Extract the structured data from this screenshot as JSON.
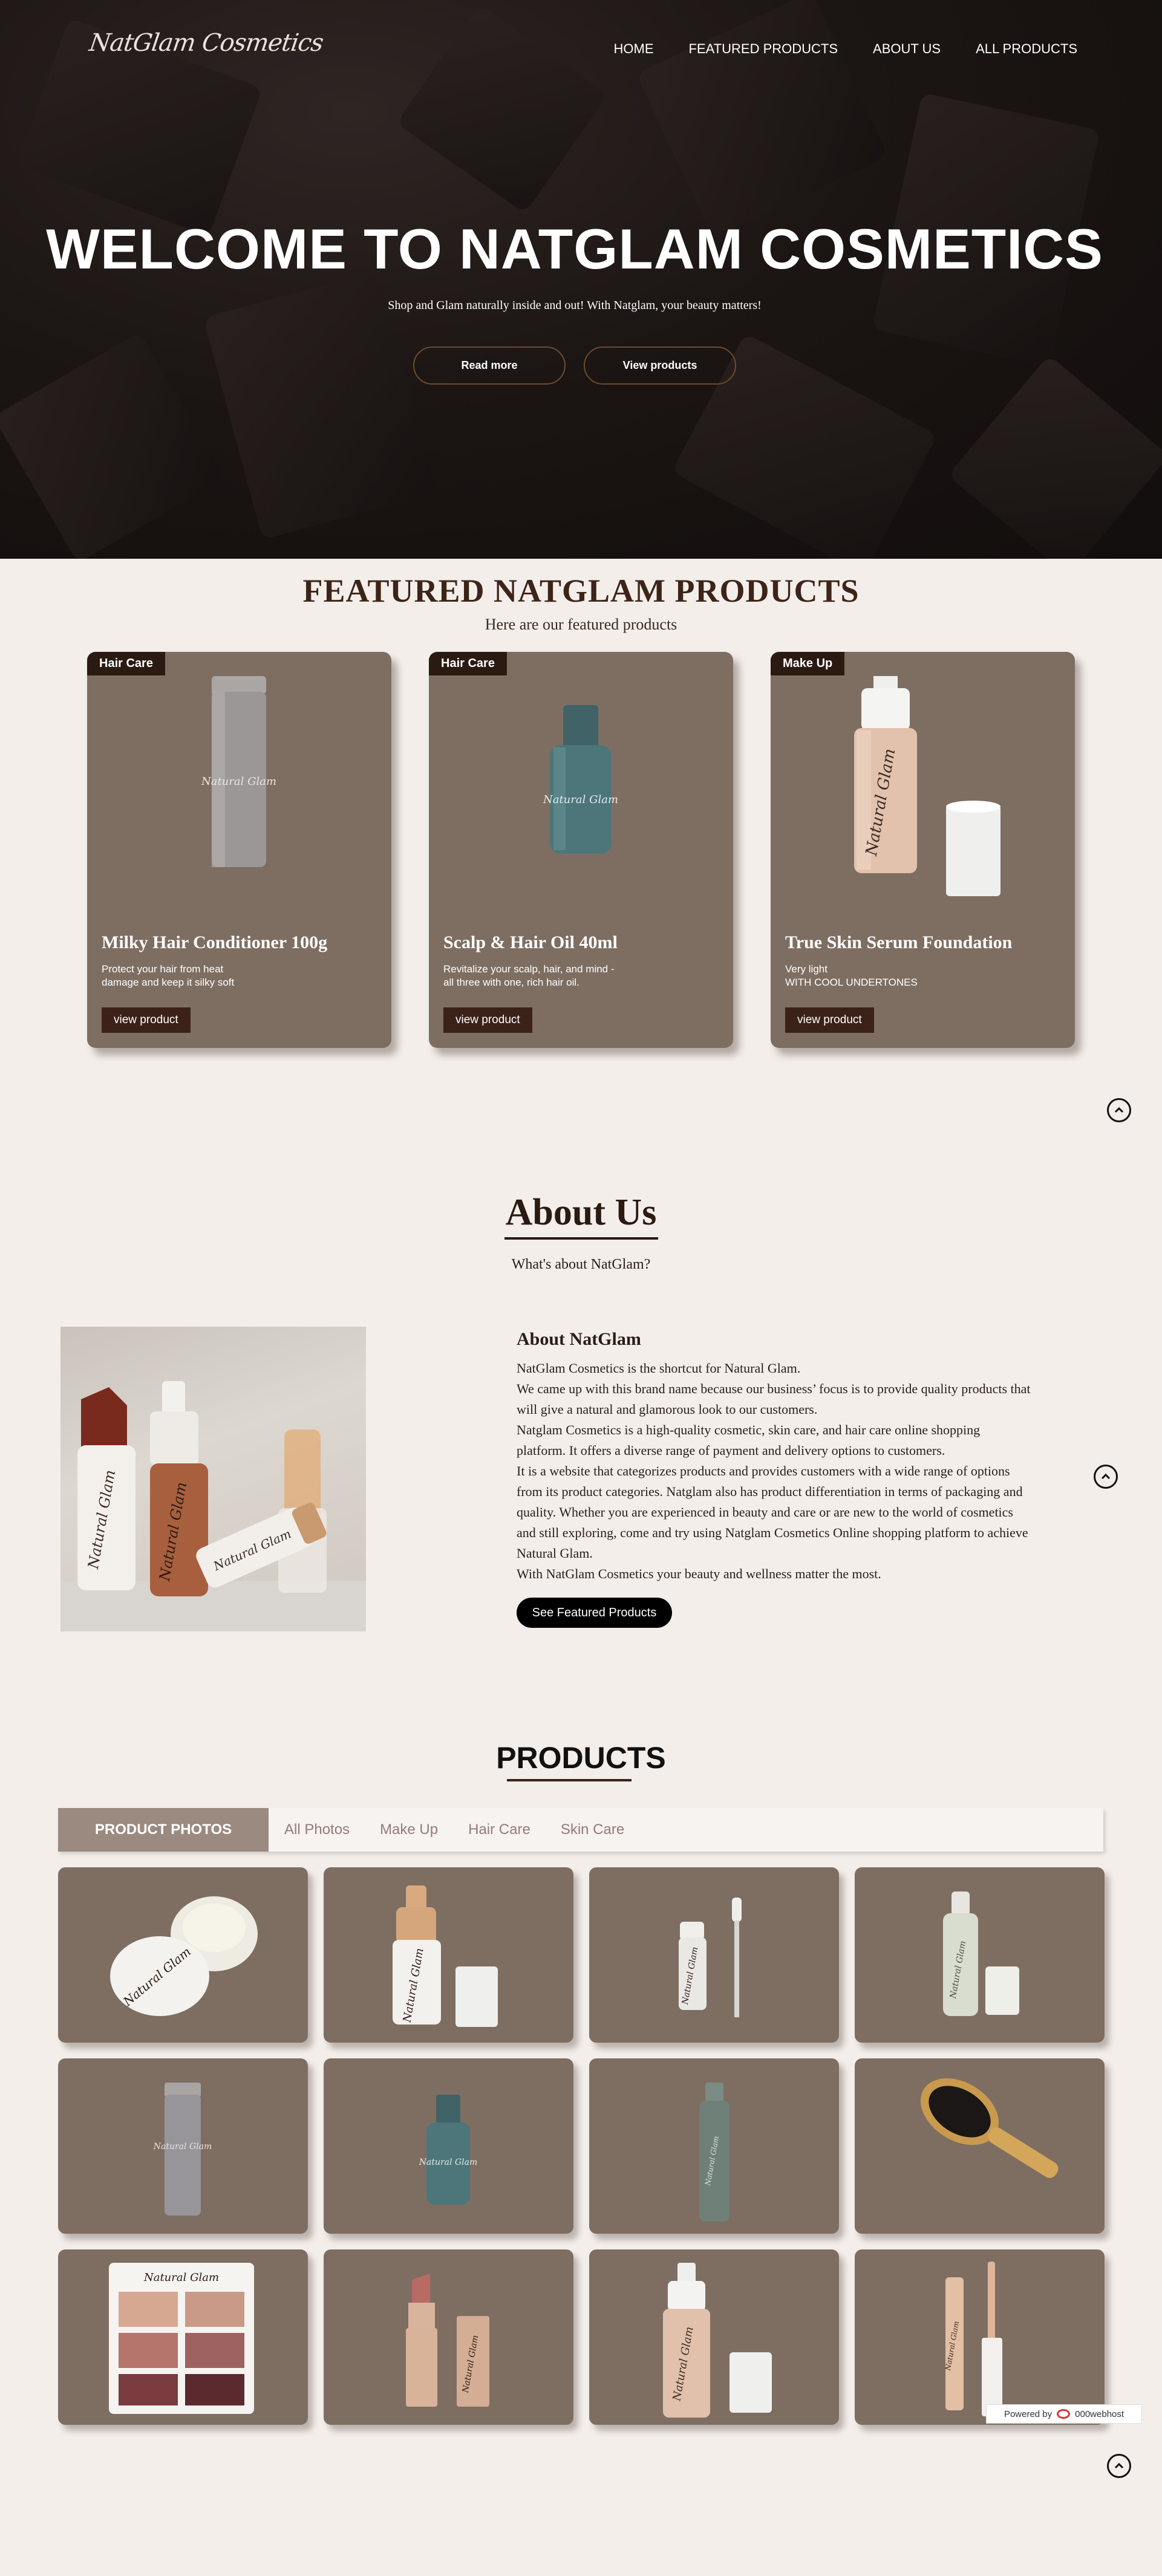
{
  "brand": {
    "logo_text": "NatGlam Cosmetics"
  },
  "nav": [
    {
      "label": "HOME"
    },
    {
      "label": "FEATURED PRODUCTS"
    },
    {
      "label": "ABOUT US"
    },
    {
      "label": "ALL PRODUCTS"
    }
  ],
  "hero": {
    "title": "WELCOME TO NATGLAM COSMETICS",
    "subtitle": "Shop and Glam naturally inside and out! With Natglam, your beauty matters!",
    "read_more": "Read more",
    "view_products": "View products"
  },
  "featured": {
    "title": "FEATURED NATGLAM PRODUCTS",
    "subtitle": "Here are our featured products",
    "cards": [
      {
        "badge": "Hair Care",
        "name": "Milky Hair Conditioner 100g",
        "desc": "Protect your hair from heat\ndamage and keep it silky soft",
        "button": "view product"
      },
      {
        "badge": "Hair Care",
        "name": "Scalp & Hair Oil 40ml",
        "desc": "Revitalize your scalp, hair, and mind -\nall three with one, rich hair oil.",
        "button": "view product"
      },
      {
        "badge": "Make Up",
        "name": "True Skin Serum Foundation",
        "desc": "Very light\nWITH COOL UNDERTONES",
        "button": "view product"
      }
    ]
  },
  "about": {
    "title": "About Us",
    "subtitle": "What's about NatGlam?",
    "heading": "About NatGlam",
    "paragraphs": [
      "NatGlam Cosmetics is the shortcut for Natural Glam.",
      "We came up with this brand name because our business’ focus is to provide quality products that will give a natural and glamorous look to our customers.",
      "Natglam Cosmetics is a high-quality cosmetic, skin care, and hair care online shopping platform. It offers a diverse range of payment and delivery options to customers.",
      "It is a website that categorizes products and provides customers with a wide range of options from its product categories. Natglam also has product differentiation in terms of packaging and quality. Whether you are experienced in beauty and care or are new to the world of cosmetics and still exploring, come and try using Natglam Cosmetics Online shopping platform to achieve Natural Glam.",
      "With NatGlam Cosmetics your beauty and wellness matter the most."
    ],
    "cta": "See Featured Products"
  },
  "products": {
    "title": "PRODUCTS",
    "tab_header": "PRODUCT PHOTOS",
    "tabs": [
      "All Photos",
      "Make Up",
      "Hair Care",
      "Skin Care"
    ]
  },
  "footer": {
    "powered_by": "Powered by",
    "host": "000webhost"
  },
  "colors": {
    "card_bg": "#7e6e62",
    "accent_dark": "#3b2117",
    "page_bg": "#f3eeea"
  },
  "icons": {
    "scroll_top": "chevron-up-circle-icon"
  }
}
